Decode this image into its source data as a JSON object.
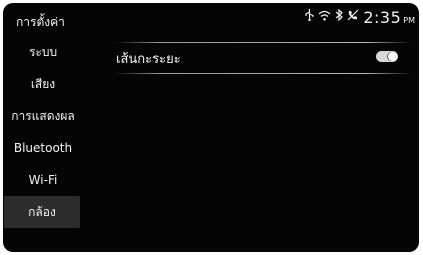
{
  "header": {
    "title": "การตั้งค่า",
    "status_icons": [
      "usb-icon",
      "wifi-icon",
      "bluetooth-icon",
      "phone-disconnected-icon"
    ],
    "time": "2:35",
    "ampm": "PM"
  },
  "sidebar": {
    "items": [
      {
        "label": "ระบบ",
        "active": false
      },
      {
        "label": "เสียง",
        "active": false
      },
      {
        "label": "การแสดงผล",
        "active": false
      },
      {
        "label": "Bluetooth",
        "active": false
      },
      {
        "label": "Wi-Fi",
        "active": false
      },
      {
        "label": "กล้อง",
        "active": true
      }
    ]
  },
  "main": {
    "setting_label": "เส้นกะระยะ",
    "setting_enabled": true
  }
}
